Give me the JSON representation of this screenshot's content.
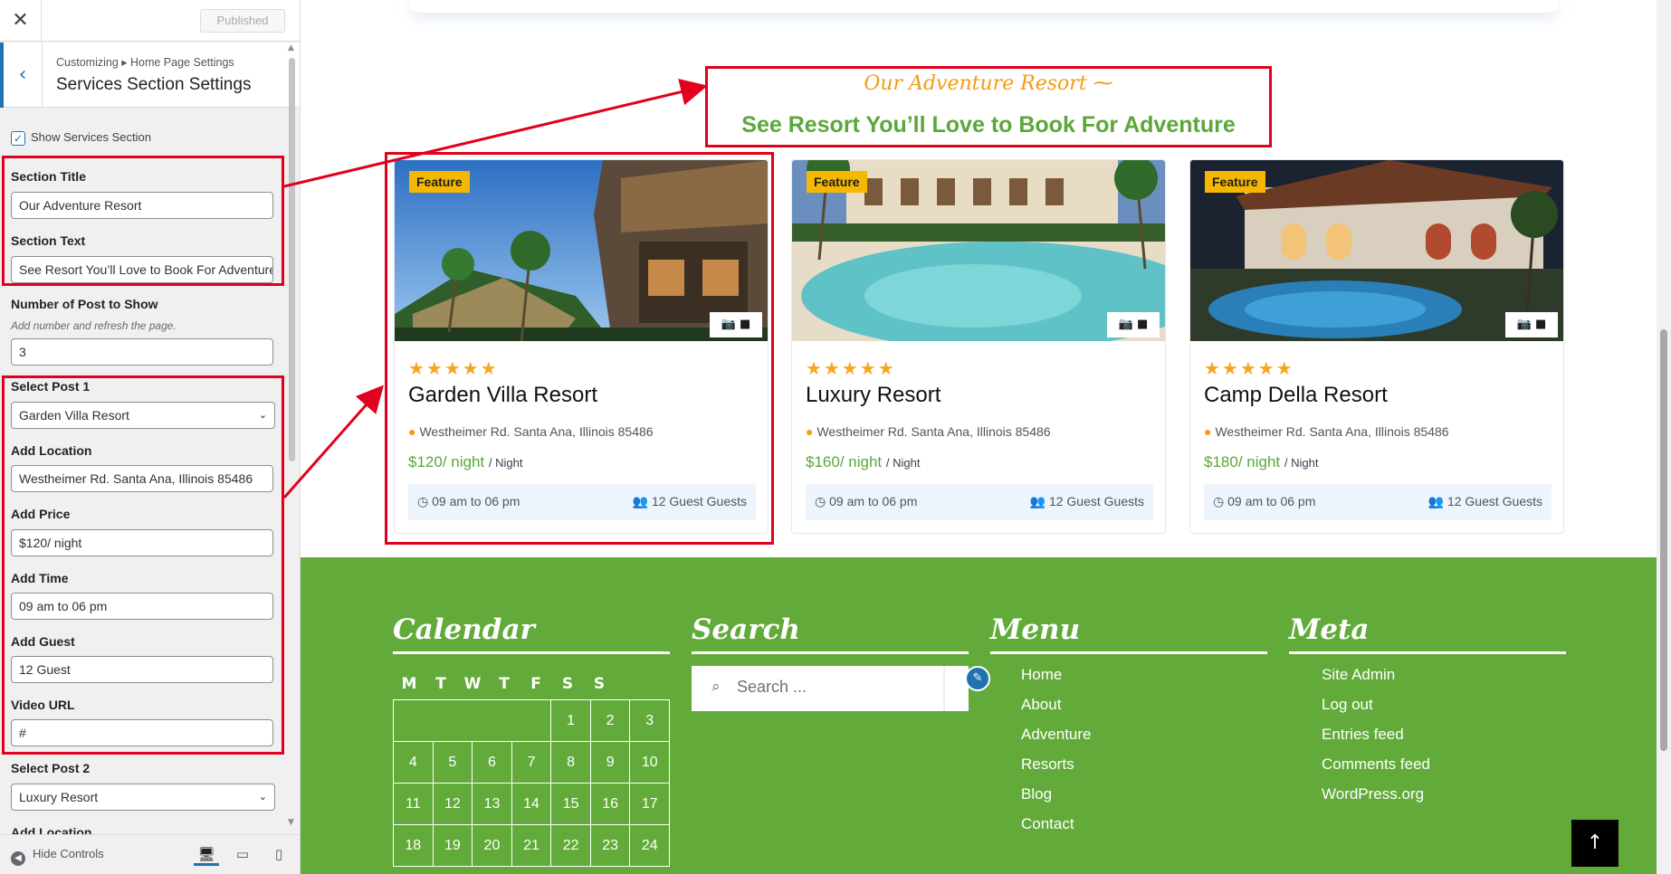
{
  "customizer": {
    "close_icon": "close-icon",
    "published_label": "Published",
    "breadcrumb": "Customizing ▸ Home Page Settings",
    "panel_title": "Services Section Settings",
    "show_services_label": "Show Services Section",
    "show_services_checked": true,
    "fields": {
      "section_title_label": "Section Title",
      "section_title_value": "Our Adventure Resort",
      "section_text_label": "Section Text",
      "section_text_value": "See Resort You’ll Love to Book For Adventure",
      "num_posts_label": "Number of Post to Show",
      "num_posts_desc": "Add number and refresh the page.",
      "num_posts_value": "3",
      "select_post1_label": "Select Post 1",
      "select_post1_value": "Garden Villa Resort",
      "location_label": "Add Location",
      "location_value": "Westheimer Rd. Santa Ana, Illinois 85486",
      "price_label": "Add Price",
      "price_value": "$120/ night",
      "time_label": "Add Time",
      "time_value": "09 am to 06 pm",
      "guest_label": "Add Guest",
      "guest_value": "12 Guest",
      "video_label": "Video URL",
      "video_value": "#",
      "select_post2_label": "Select Post 2",
      "select_post2_value": "Luxury Resort",
      "location2_label": "Add Location"
    },
    "hide_controls_label": "Hide Controls"
  },
  "section": {
    "subtitle": "Our Adventure Resort ⁓",
    "title": "See Resort You’ll Love to Book For Adventure"
  },
  "cards": [
    {
      "badge": "Feature",
      "stars": "★★★★★",
      "title": "Garden Villa Resort",
      "location": "Westheimer Rd. Santa Ana, Illinois 85486",
      "price": "$120/ night",
      "per": "/ Night",
      "time": "09 am to 06 pm",
      "guests": "12 Guest Guests"
    },
    {
      "badge": "Feature",
      "stars": "★★★★★",
      "title": "Luxury Resort",
      "location": "Westheimer Rd. Santa Ana, Illinois 85486",
      "price": "$160/ night",
      "per": "/ Night",
      "time": "09 am to 06 pm",
      "guests": "12 Guest Guests"
    },
    {
      "badge": "Feature",
      "stars": "★★★★★",
      "title": "Camp Della Resort",
      "location": "Westheimer Rd. Santa Ana, Illinois 85486",
      "price": "$180/ night",
      "per": "/ Night",
      "time": "09 am to 06 pm",
      "guests": "12 Guest Guests"
    }
  ],
  "footer": {
    "calendar_title": "Calendar",
    "weekdays": [
      "M",
      "T",
      "W",
      "T",
      "F",
      "S",
      "S"
    ],
    "weeks": [
      [
        "",
        "",
        "",
        "",
        "1",
        "2",
        "3"
      ],
      [
        "4",
        "5",
        "6",
        "7",
        "8",
        "9",
        "10"
      ],
      [
        "11",
        "12",
        "13",
        "14",
        "15",
        "16",
        "17"
      ],
      [
        "18",
        "19",
        "20",
        "21",
        "22",
        "23",
        "24"
      ]
    ],
    "search_title": "Search",
    "search_placeholder": "Search ...",
    "menu_title": "Menu",
    "menu_items": [
      "Home",
      "About",
      "Adventure",
      "Resorts",
      "Blog",
      "Contact"
    ],
    "meta_title": "Meta",
    "meta_items": [
      "Site Admin",
      "Log out",
      "Entries feed",
      "Comments feed",
      "WordPress.org"
    ]
  },
  "colors": {
    "accent_green": "#62ab3b",
    "title_green": "#5ba739",
    "badge_yellow": "#f5b700",
    "highlight_red": "#e1001d",
    "wp_blue": "#2271b1"
  }
}
